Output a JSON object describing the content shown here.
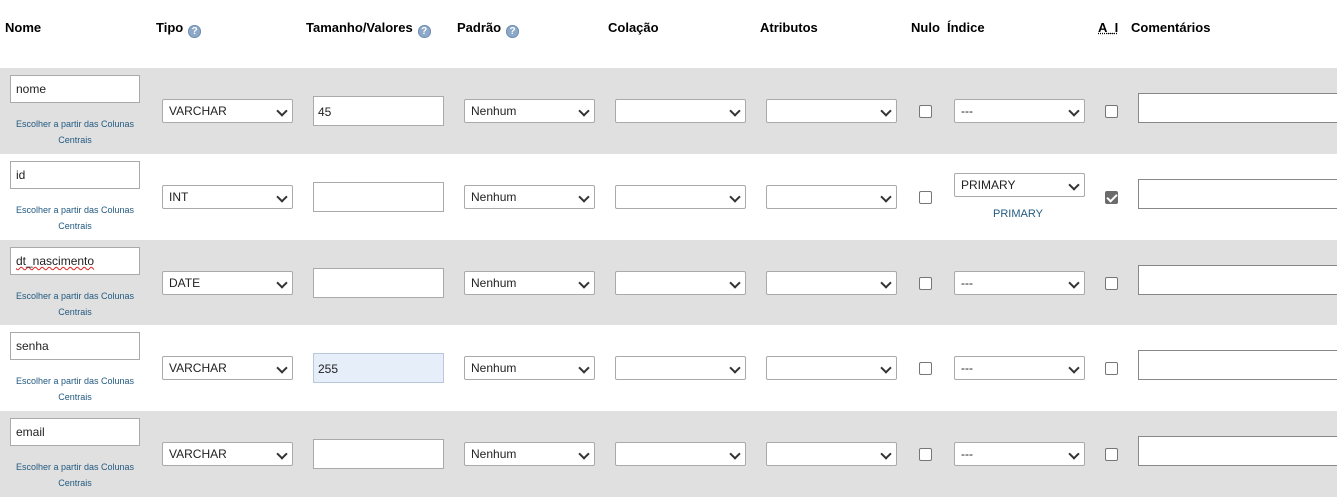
{
  "headers": {
    "nome": "Nome",
    "tipo": "Tipo",
    "tamanho": "Tamanho/Valores",
    "padrao": "Padrão",
    "colacao": "Colação",
    "atributos": "Atributos",
    "nulo": "Nulo",
    "indice": "Índice",
    "ai": "A_I",
    "comentarios": "Comentários"
  },
  "help_icon": "?",
  "central_link": "Escolher a partir das Colunas Centrais",
  "rows": [
    {
      "name": "nome",
      "type": "VARCHAR",
      "length": "45",
      "default": "Nenhum",
      "collation": "",
      "attributes": "",
      "null": false,
      "index": "---",
      "index_label": "",
      "ai": false,
      "comment": ""
    },
    {
      "name": "id",
      "type": "INT",
      "length": "",
      "default": "Nenhum",
      "collation": "",
      "attributes": "",
      "null": false,
      "index": "PRIMARY",
      "index_label": "PRIMARY",
      "ai": true,
      "comment": ""
    },
    {
      "name": "dt_nascimento",
      "type": "DATE",
      "length": "",
      "default": "Nenhum",
      "collation": "",
      "attributes": "",
      "null": false,
      "index": "---",
      "index_label": "",
      "ai": false,
      "comment": ""
    },
    {
      "name": "senha",
      "type": "VARCHAR",
      "length": "255",
      "default": "Nenhum",
      "collation": "",
      "attributes": "",
      "null": false,
      "index": "---",
      "index_label": "",
      "ai": false,
      "comment": ""
    },
    {
      "name": "email",
      "type": "VARCHAR",
      "length": "",
      "default": "Nenhum",
      "collation": "",
      "attributes": "",
      "null": false,
      "index": "---",
      "index_label": "",
      "ai": false,
      "comment": ""
    }
  ],
  "colors": {
    "link": "#235a81",
    "row_alt": "#e0e0e0"
  }
}
